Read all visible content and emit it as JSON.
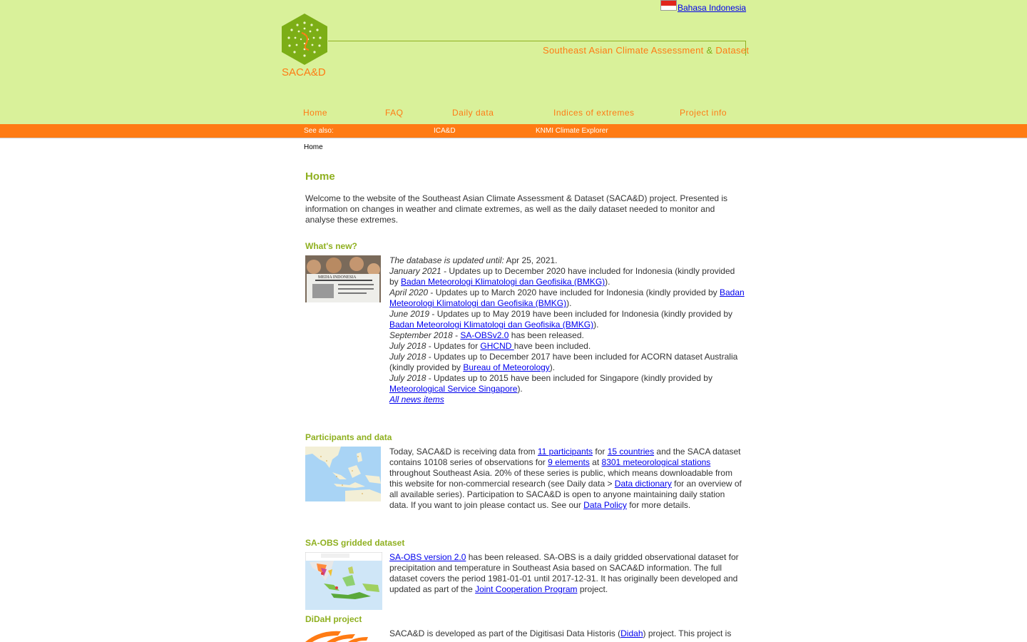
{
  "header": {
    "language_link": "Bahasa Indonesia",
    "logo_text": "SACA&D",
    "tagline_part1": "Southeast Asian Climate Assessment ",
    "tagline_amp": "&",
    "tagline_part2": " Dataset"
  },
  "nav": [
    "Home",
    "FAQ",
    "Daily data",
    "Indices of extremes",
    "Project info"
  ],
  "subnav": {
    "see_also": "See also:",
    "links": [
      "ICA&D",
      "KNMI Climate Explorer"
    ]
  },
  "breadcrumb": "Home",
  "page_title": "Home",
  "intro": "Welcome to the website of the Southeast Asian Climate Assessment & Dataset (SACA&D) project. Presented is information on changes in weather and climate extremes, as well as the daily dataset needed to monitor and analyse these extremes.",
  "whats_new": {
    "heading": "What's new?",
    "thumb_text": "MEDIA INDONESIA",
    "updated_label": "The database is updated until:",
    "updated_date": " Apr 25, 2021.",
    "items": [
      {
        "date": "January 2021",
        "pre": " - Updates up to December 2020 have included for Indonesia (kindly provided by ",
        "link": "Badan Meteorologi Klimatologi dan Geofisika (BMKG)",
        "post": ")."
      },
      {
        "date": "April 2020",
        "pre": " - Updates up to March 2020 have included for Indonesia (kindly provided by ",
        "link": "Badan Meteorologi Klimatologi dan Geofisika (BMKG)",
        "post": ")."
      },
      {
        "date": "June 2019",
        "pre": " - Updates up to May 2019 have been included for Indonesia (kindly provided by ",
        "link": "Badan Meteorologi Klimatologi dan Geofisika (BMKG)",
        "post": ")."
      },
      {
        "date": "September 2018",
        "pre": " - ",
        "link": "SA-OBSv2.0",
        "post": " has been released."
      },
      {
        "date": "July 2018",
        "pre": " - Updates for ",
        "link": "GHCND ",
        "post": "have been included."
      },
      {
        "date": "July 2018",
        "pre": " - Updates up to December 2017 have been included for ACORN dataset Australia (kindly provided by ",
        "link": "Bureau of Meteorology",
        "post": ")."
      },
      {
        "date": "July 2018",
        "pre": " - Updates up to 2015 have been included for Singapore (kindly provided by ",
        "link": "Meteorological Service Singapore",
        "post": ")."
      }
    ],
    "all_news": "All news items"
  },
  "participants": {
    "heading": "Participants and data",
    "t1": "Today, SACA&D is receiving data from ",
    "l1": "11 participants",
    "t2": " for ",
    "l2": "15 countries",
    "t3": " and the SACA dataset contains 10108 series of observations for ",
    "l3": "9 elements",
    "t4": " at ",
    "l4": "8301 meteorological stations",
    "t5": " throughout Southeast Asia. 20% of these series is public, which means downloadable from this website for non-commercial research (see Daily data > ",
    "l5": "Data dictionary",
    "t6": " for an overview of all available series). Participation to SACA&D is open to anyone maintaining daily station data. If you want to join please contact us. See our ",
    "l6": "Data Policy",
    "t7": " for more details."
  },
  "saobs": {
    "heading": "SA-OBS gridded dataset",
    "l1": "SA-OBS version 2.0",
    "t1": " has been released. SA-OBS is a daily gridded observational dataset for precipitation and temperature in Southeast Asia based on SACA&D information. The full dataset covers the period 1981-01-01 until 2017-12-31. It has originally been developed and updated as part of the ",
    "l2": "Joint Cooperation Program",
    "t2": " project."
  },
  "didah": {
    "heading": "DiDaH project",
    "t1": "SACA&D is developed as part of the Digitisasi Data Historis (",
    "l1": "Didah",
    "t2": ") project. This project is"
  },
  "colors": {
    "band": "#d9f19a",
    "orange": "#ff7b14",
    "green": "#8fb020",
    "link": "#0000ee"
  }
}
